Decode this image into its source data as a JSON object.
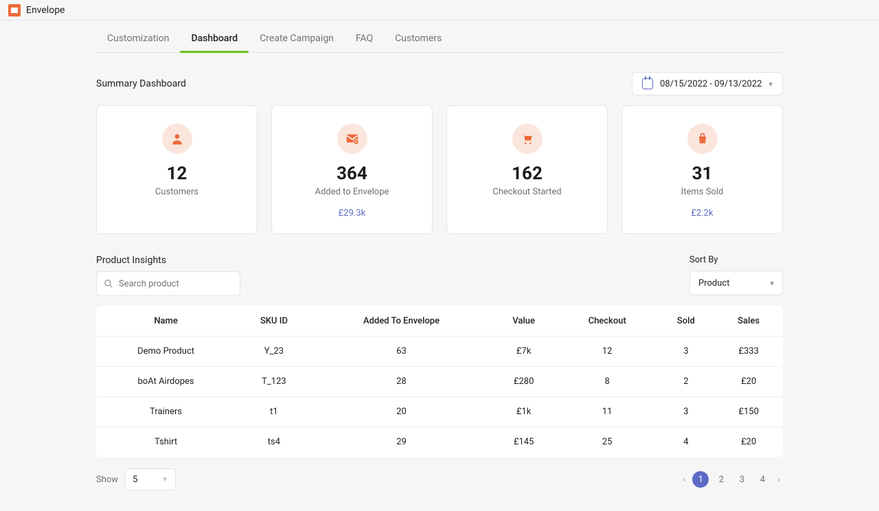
{
  "app": {
    "name": "Envelope"
  },
  "tabs": {
    "items": [
      "Customization",
      "Dashboard",
      "Create Campaign",
      "FAQ",
      "Customers"
    ],
    "active": 1
  },
  "summary": {
    "title": "Summary Dashboard",
    "date_range": "08/15/2022 - 09/13/2022",
    "cards": [
      {
        "icon": "user",
        "value": "12",
        "label": "Customers",
        "sub": ""
      },
      {
        "icon": "envelope",
        "value": "364",
        "label": "Added to Envelope",
        "sub": "£29.3k"
      },
      {
        "icon": "cart",
        "value": "162",
        "label": "Checkout Started",
        "sub": ""
      },
      {
        "icon": "bag",
        "value": "31",
        "label": "Items Sold",
        "sub": "£2.2k"
      }
    ]
  },
  "insights": {
    "title": "Product Insights",
    "search_placeholder": "Search product",
    "sort_label": "Sort By",
    "sort_value": "Product",
    "columns": [
      "Name",
      "SKU ID",
      "Added To Envelope",
      "Value",
      "Checkout",
      "Sold",
      "Sales"
    ],
    "rows": [
      {
        "name": "Demo Product",
        "sku": "Y_23",
        "added": "63",
        "value": "£7k",
        "checkout": "12",
        "sold": "3",
        "sales": "£333"
      },
      {
        "name": "boAt Airdopes",
        "sku": "T_123",
        "added": "28",
        "value": "£280",
        "checkout": "8",
        "sold": "2",
        "sales": "£20"
      },
      {
        "name": "Trainers",
        "sku": "t1",
        "added": "20",
        "value": "£1k",
        "checkout": "11",
        "sold": "3",
        "sales": "£150"
      },
      {
        "name": "Tshirt",
        "sku": "ts4",
        "added": "29",
        "value": "£145",
        "checkout": "25",
        "sold": "4",
        "sales": "£20"
      }
    ]
  },
  "pagination": {
    "show_label": "Show",
    "show_value": "5",
    "pages": [
      "1",
      "2",
      "3",
      "4"
    ],
    "active": 0
  }
}
